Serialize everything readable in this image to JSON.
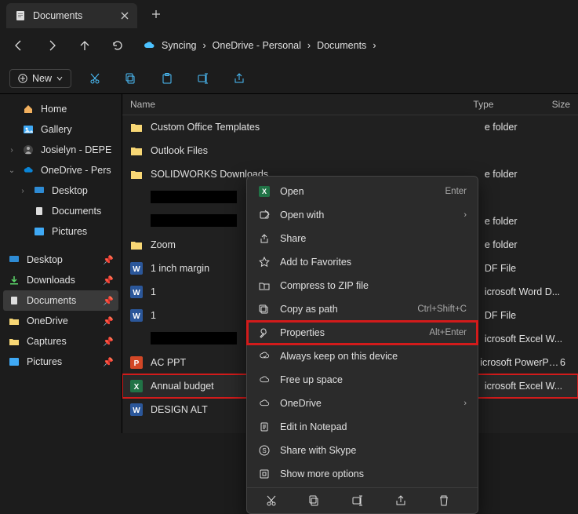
{
  "window": {
    "tab_title": "Documents"
  },
  "navbar": {
    "sync_label": "Syncing",
    "crumbs": [
      "OneDrive - Personal",
      "Documents"
    ]
  },
  "toolbar": {
    "new_label": "New"
  },
  "navpane": {
    "items": [
      {
        "label": "Home"
      },
      {
        "label": "Gallery"
      },
      {
        "label": "Josielyn - DEPE"
      },
      {
        "label": "OneDrive - Pers"
      },
      {
        "label": "Desktop"
      },
      {
        "label": "Documents"
      },
      {
        "label": "Pictures"
      },
      {
        "label": "Desktop"
      },
      {
        "label": "Downloads"
      },
      {
        "label": "Documents"
      },
      {
        "label": "OneDrive"
      },
      {
        "label": "Captures"
      },
      {
        "label": "Pictures"
      }
    ]
  },
  "list_header": {
    "name": "Name",
    "type": "Type",
    "size": "Size"
  },
  "files": [
    {
      "name": "Custom Office Templates",
      "icon": "folder",
      "type": "e folder",
      "size": ""
    },
    {
      "name": "Outlook Files",
      "icon": "folder",
      "type": "",
      "size": ""
    },
    {
      "name": "SOLIDWORKS Downloads",
      "icon": "folder",
      "type": "e folder",
      "size": ""
    },
    {
      "name": "",
      "icon": "redact",
      "type": "",
      "size": ""
    },
    {
      "name": "",
      "icon": "redact",
      "type": "e folder",
      "size": ""
    },
    {
      "name": "Zoom",
      "icon": "folder",
      "type": "e folder",
      "size": ""
    },
    {
      "name": "1 inch margin",
      "icon": "word",
      "type": "DF File",
      "size": ""
    },
    {
      "name": "1",
      "icon": "word",
      "type": "icrosoft Word D...",
      "size": ""
    },
    {
      "name": "1",
      "icon": "word",
      "type": "DF File",
      "size": ""
    },
    {
      "name": "",
      "icon": "redact",
      "type": "icrosoft Excel W...",
      "size": ""
    },
    {
      "name": "AC PPT",
      "icon": "ppt",
      "type": "icrosoft PowerPo...",
      "size": "6"
    },
    {
      "name": "Annual budget",
      "icon": "excel",
      "type": "icrosoft Excel W...",
      "size": "",
      "selected": true
    },
    {
      "name": "DESIGN ALT",
      "icon": "word",
      "type": "",
      "size": ""
    }
  ],
  "context_menu": {
    "items": [
      {
        "label": "Open",
        "shortcut": "Enter",
        "icon": "excel"
      },
      {
        "label": "Open with",
        "submenu": true,
        "icon": "openwith"
      },
      {
        "label": "Share",
        "icon": "share"
      },
      {
        "label": "Add to Favorites",
        "icon": "star"
      },
      {
        "label": "Compress to ZIP file",
        "icon": "zip"
      },
      {
        "label": "Copy as path",
        "shortcut": "Ctrl+Shift+C",
        "icon": "copypath"
      },
      {
        "label": "Properties",
        "shortcut": "Alt+Enter",
        "icon": "wrench",
        "highlight": true
      },
      {
        "label": "Always keep on this device",
        "icon": "cloudkeep"
      },
      {
        "label": "Free up space",
        "icon": "cloud"
      },
      {
        "label": "OneDrive",
        "submenu": true,
        "icon": "onedrive"
      },
      {
        "label": "Edit in Notepad",
        "icon": "notepad"
      },
      {
        "label": "Share with Skype",
        "icon": "skype"
      },
      {
        "label": "Show more options",
        "icon": "more"
      }
    ]
  }
}
